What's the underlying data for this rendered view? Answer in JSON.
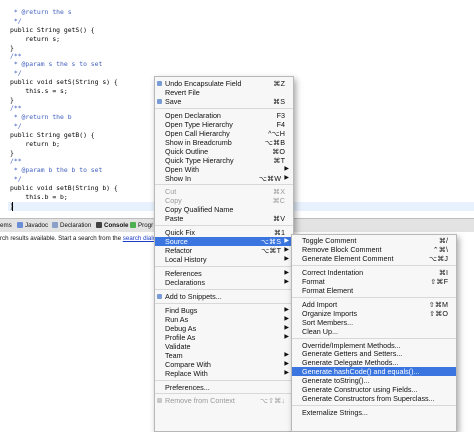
{
  "editor": {
    "lines": [
      {
        "t": " * @return the s",
        "c": "comment"
      },
      {
        "t": " */",
        "c": "comment"
      },
      {
        "t": "public String getS() {",
        "c": "code"
      },
      {
        "t": "    return s;",
        "c": "code"
      },
      {
        "t": "}",
        "c": "code"
      },
      {
        "t": "/**",
        "c": "comment"
      },
      {
        "t": " * @param s the s to set",
        "c": "comment"
      },
      {
        "t": " */",
        "c": "comment"
      },
      {
        "t": "public void setS(String s) {",
        "c": "code"
      },
      {
        "t": "    this.s = s;",
        "c": "code"
      },
      {
        "t": "}",
        "c": "code"
      },
      {
        "t": "/**",
        "c": "comment"
      },
      {
        "t": " * @return the b",
        "c": "comment"
      },
      {
        "t": " */",
        "c": "comment"
      },
      {
        "t": "public String getB() {",
        "c": "code"
      },
      {
        "t": "    return b;",
        "c": "code"
      },
      {
        "t": "}",
        "c": "code"
      },
      {
        "t": "/**",
        "c": "comment"
      },
      {
        "t": " * @param b the b to set",
        "c": "comment"
      },
      {
        "t": " */",
        "c": "comment"
      },
      {
        "t": "public void setB(String b) {",
        "c": "code"
      },
      {
        "t": "    this.b = b;",
        "c": "code"
      },
      {
        "t": "}",
        "c": "code"
      }
    ]
  },
  "views": {
    "tabs": [
      "ems",
      "Javadoc",
      "Declaration",
      "Console",
      "Progr"
    ],
    "console_message": "rch results available. Start a search from the",
    "console_link": "search dialog"
  },
  "context_menu": {
    "items": [
      {
        "label": "Undo Encapsulate Field",
        "shortcut": "⌘Z",
        "icon": true
      },
      {
        "label": "Revert File",
        "shortcut": ""
      },
      {
        "label": "Save",
        "shortcut": "⌘S",
        "icon": true
      },
      {
        "sep": true
      },
      {
        "label": "Open Declaration",
        "shortcut": "F3"
      },
      {
        "label": "Open Type Hierarchy",
        "shortcut": "F4"
      },
      {
        "label": "Open Call Hierarchy",
        "shortcut": "^⌥H"
      },
      {
        "label": "Show in Breadcrumb",
        "shortcut": "⌥⌘B"
      },
      {
        "label": "Quick Outline",
        "shortcut": "⌘O"
      },
      {
        "label": "Quick Type Hierarchy",
        "shortcut": "⌘T"
      },
      {
        "label": "Open With",
        "shortcut": "",
        "submenu": true
      },
      {
        "label": "Show In",
        "shortcut": "⌥⌘W",
        "submenu": true
      },
      {
        "sep": true
      },
      {
        "label": "Cut",
        "shortcut": "⌘X",
        "disabled": true
      },
      {
        "label": "Copy",
        "shortcut": "⌘C",
        "disabled": true
      },
      {
        "label": "Copy Qualified Name",
        "shortcut": ""
      },
      {
        "label": "Paste",
        "shortcut": "⌘V"
      },
      {
        "sep": true
      },
      {
        "label": "Quick Fix",
        "shortcut": "⌘1"
      },
      {
        "label": "Source",
        "shortcut": "⌥⌘S",
        "submenu": true,
        "selected": true
      },
      {
        "label": "Refactor",
        "shortcut": "⌥⌘T",
        "submenu": true
      },
      {
        "label": "Local History",
        "shortcut": "",
        "submenu": true
      },
      {
        "sep": true
      },
      {
        "label": "References",
        "shortcut": "",
        "submenu": true
      },
      {
        "label": "Declarations",
        "shortcut": "",
        "submenu": true
      },
      {
        "sep": true
      },
      {
        "label": "Add to Snippets...",
        "shortcut": "",
        "icon": true
      },
      {
        "sep": true
      },
      {
        "label": "Find Bugs",
        "shortcut": "",
        "submenu": true
      },
      {
        "label": "Run As",
        "shortcut": "",
        "submenu": true
      },
      {
        "label": "Debug As",
        "shortcut": "",
        "submenu": true
      },
      {
        "label": "Profile As",
        "shortcut": "",
        "submenu": true
      },
      {
        "label": "Validate",
        "shortcut": ""
      },
      {
        "label": "Team",
        "shortcut": "",
        "submenu": true
      },
      {
        "label": "Compare With",
        "shortcut": "",
        "submenu": true
      },
      {
        "label": "Replace With",
        "shortcut": "",
        "submenu": true
      },
      {
        "sep": true
      },
      {
        "label": "Preferences...",
        "shortcut": ""
      },
      {
        "sep": true
      },
      {
        "label": "Remove from Context",
        "shortcut": "⌥⇧⌘↓",
        "disabled": true,
        "icon": true
      }
    ]
  },
  "source_submenu": {
    "items": [
      {
        "label": "Toggle Comment",
        "shortcut": "⌘/"
      },
      {
        "label": "Remove Block Comment",
        "shortcut": "⌃⌘\\"
      },
      {
        "label": "Generate Element Comment",
        "shortcut": "⌥⌘J"
      },
      {
        "sep": true
      },
      {
        "label": "Correct Indentation",
        "shortcut": "⌘I"
      },
      {
        "label": "Format",
        "shortcut": "⇧⌘F"
      },
      {
        "label": "Format Element",
        "shortcut": ""
      },
      {
        "sep": true
      },
      {
        "label": "Add Import",
        "shortcut": "⇧⌘M"
      },
      {
        "label": "Organize Imports",
        "shortcut": "⇧⌘O"
      },
      {
        "label": "Sort Members...",
        "shortcut": ""
      },
      {
        "label": "Clean Up...",
        "shortcut": ""
      },
      {
        "sep": true
      },
      {
        "label": "Override/Implement Methods...",
        "shortcut": ""
      },
      {
        "label": "Generate Getters and Setters...",
        "shortcut": ""
      },
      {
        "label": "Generate Delegate Methods...",
        "shortcut": ""
      },
      {
        "label": "Generate hashCode() and equals()...",
        "shortcut": "",
        "selected": true
      },
      {
        "label": "Generate toString()...",
        "shortcut": ""
      },
      {
        "label": "Generate Constructor using Fields...",
        "shortcut": ""
      },
      {
        "label": "Generate Constructors from Superclass...",
        "shortcut": ""
      },
      {
        "sep": true
      },
      {
        "label": "Externalize Strings...",
        "shortcut": ""
      }
    ]
  },
  "colors": {
    "selection": "#3b76e0",
    "keyword": "#7f0055",
    "comment": "#3f5fbf"
  }
}
